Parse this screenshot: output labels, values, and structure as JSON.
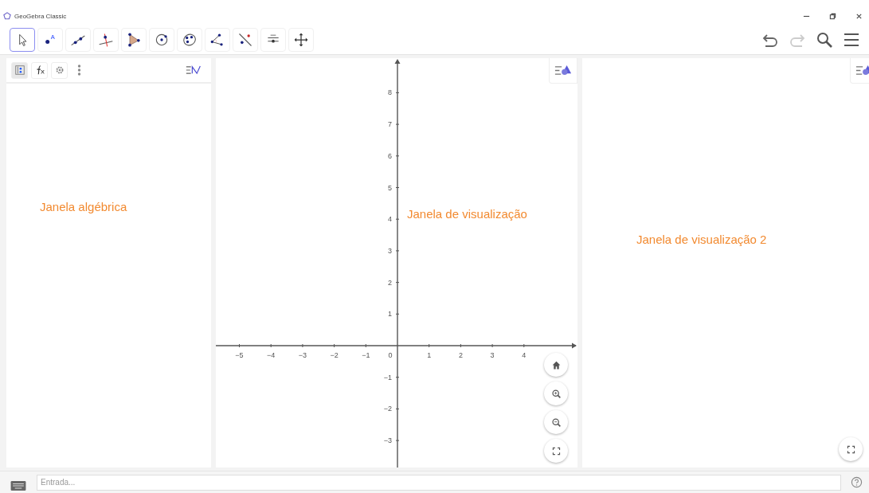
{
  "title_bar": {
    "title": "GeoGebra Classic"
  },
  "toolbar": {
    "tools": [
      {
        "kind": "move",
        "selected": true
      },
      {
        "kind": "point",
        "selected": false,
        "label": "A"
      },
      {
        "kind": "line",
        "selected": false
      },
      {
        "kind": "perpendicular",
        "selected": false
      },
      {
        "kind": "polygon",
        "selected": false
      },
      {
        "kind": "circle",
        "selected": false
      },
      {
        "kind": "conic",
        "selected": false
      },
      {
        "kind": "angle",
        "selected": false
      },
      {
        "kind": "reflect",
        "selected": false
      },
      {
        "kind": "slider",
        "selected": false
      },
      {
        "kind": "pan",
        "selected": false
      }
    ]
  },
  "algebra_view": {
    "header_buttons": [
      {
        "kind": "algebra",
        "selected": true
      },
      {
        "kind": "function",
        "selected": false
      },
      {
        "kind": "settings",
        "selected": false
      }
    ],
    "label": "Janela algébrica"
  },
  "graphics_view": {
    "label": "Janela de visualização",
    "x_axis_negative": [
      "−5",
      "−4",
      "−3",
      "−2",
      "−1"
    ],
    "x_axis_positive": [
      "1",
      "2",
      "3",
      "4"
    ],
    "origin_label": "0",
    "y_axis_positive": [
      "8",
      "7",
      "6",
      "5",
      "4",
      "3",
      "2",
      "1"
    ],
    "y_axis_negative": [
      "−1",
      "−2",
      "−3"
    ]
  },
  "graphics_view_2": {
    "label": "Janela de visualização 2"
  },
  "input_bar": {
    "placeholder": "Entrada..."
  }
}
